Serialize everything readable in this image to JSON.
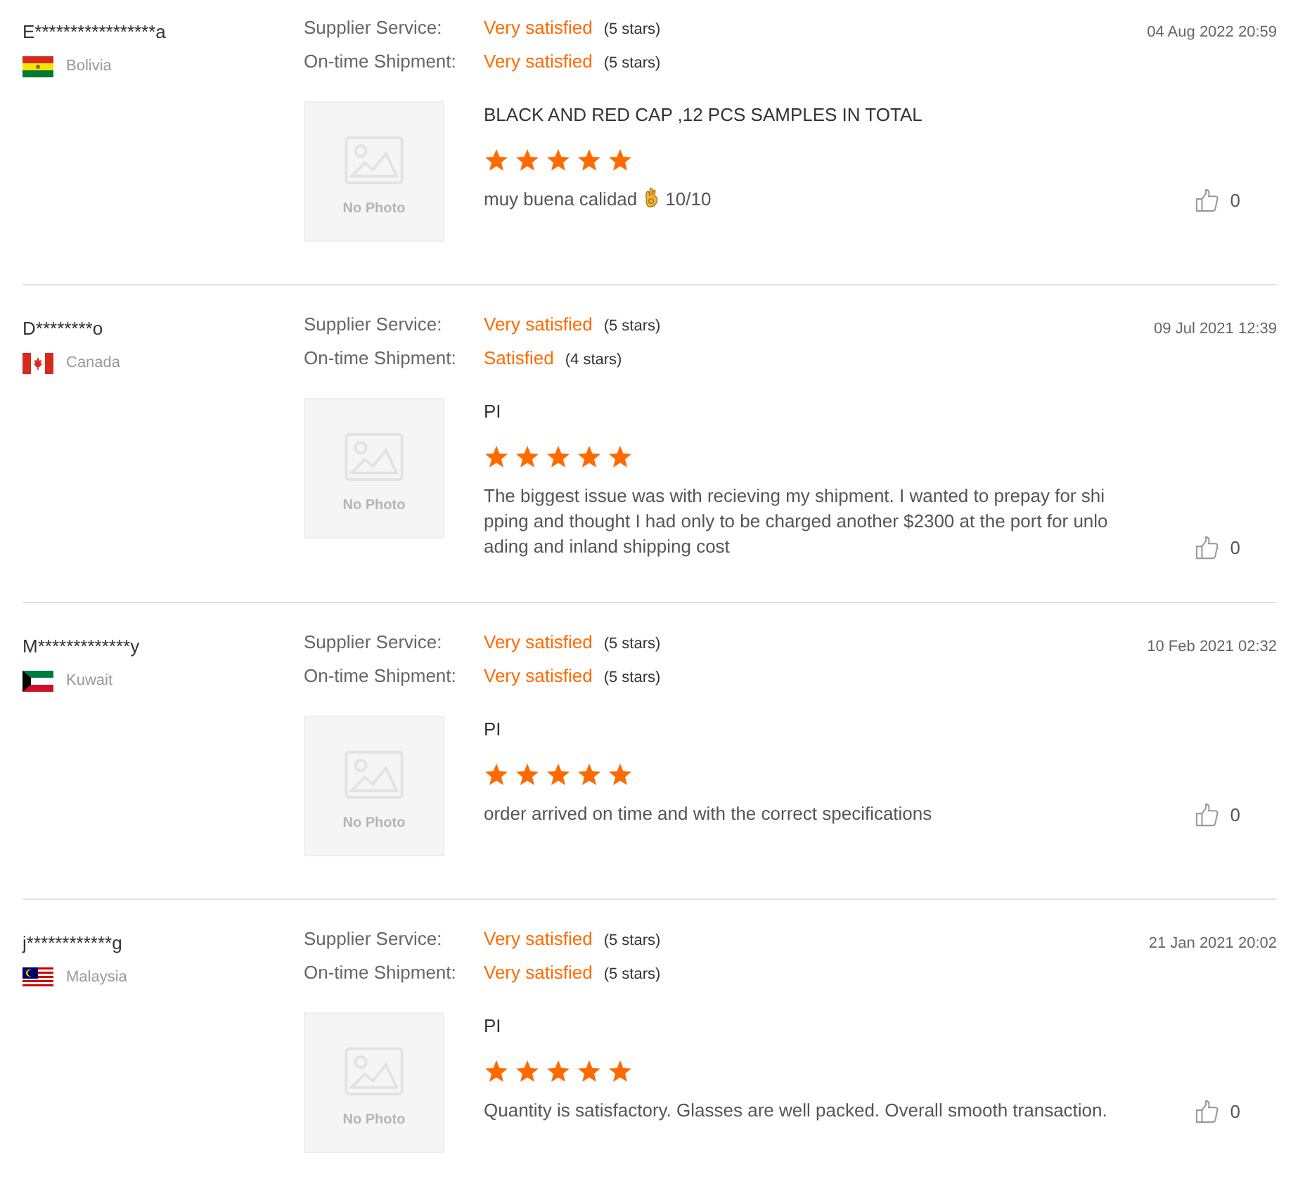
{
  "reviews": [
    {
      "name": "E*****************a",
      "country": "Bolivia",
      "kind": "bolivia",
      "date": "04 Aug 2022 20:59",
      "ratings": [
        {
          "label": "Supplier Service:",
          "verdict": "Very satisfied",
          "stars_text": "(5 stars)"
        },
        {
          "label": "On-time Shipment:",
          "verdict": "Very satisfied",
          "stars_text": "(5 stars)"
        }
      ],
      "photo_placeholder": "No Photo",
      "title": "BLACK AND RED CAP ,12 PCS SAMPLES IN TOTAL",
      "stars": 5,
      "comment": [
        {
          "kind": "text",
          "text": "muy buena calidad"
        },
        {
          "kind": "emoji"
        },
        {
          "kind": "text",
          "text": "10/10"
        }
      ],
      "likes": "0"
    },
    {
      "name": "D********o",
      "country": "Canada",
      "kind": "canada",
      "date": "09 Jul 2021 12:39",
      "ratings": [
        {
          "label": "Supplier Service:",
          "verdict": "Very satisfied",
          "stars_text": "(5 stars)"
        },
        {
          "label": "On-time Shipment:",
          "verdict": "Satisfied",
          "stars_text": "(4 stars)"
        }
      ],
      "photo_placeholder": "No Photo",
      "title": "PI",
      "stars": 5,
      "comment": [
        {
          "kind": "text",
          "text": "The biggest issue was with recieving my shipment. I wanted to prepay for shipping and thought I had only to be charged another $2300 at the port for unloading and inland shipping cost"
        }
      ],
      "likes": "0"
    },
    {
      "name": "M*************y",
      "country": "Kuwait",
      "kind": "kuwait",
      "date": "10 Feb 2021 02:32",
      "ratings": [
        {
          "label": "Supplier Service:",
          "verdict": "Very satisfied",
          "stars_text": "(5 stars)"
        },
        {
          "label": "On-time Shipment:",
          "verdict": "Very satisfied",
          "stars_text": "(5 stars)"
        }
      ],
      "photo_placeholder": "No Photo",
      "title": "PI",
      "stars": 5,
      "comment": [
        {
          "kind": "text",
          "text": "order arrived on time and with the correct specifications"
        }
      ],
      "likes": "0"
    },
    {
      "name": "j************g",
      "country": "Malaysia",
      "kind": "malaysia",
      "date": "21 Jan 2021 20:02",
      "ratings": [
        {
          "label": "Supplier Service:",
          "verdict": "Very satisfied",
          "stars_text": "(5 stars)"
        },
        {
          "label": "On-time Shipment:",
          "verdict": "Very satisfied",
          "stars_text": "(5 stars)"
        }
      ],
      "photo_placeholder": "No Photo",
      "title": "PI",
      "stars": 5,
      "comment": [
        {
          "kind": "text",
          "text": "Quantity is satisfactory. Glasses are well packed. Overall smooth transaction."
        }
      ],
      "likes": "0"
    }
  ]
}
